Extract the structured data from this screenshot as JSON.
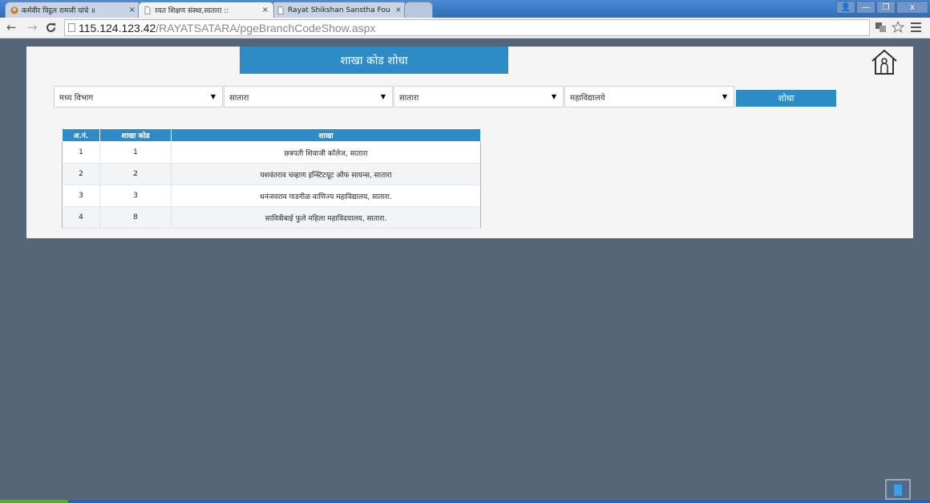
{
  "browser": {
    "tabs": [
      {
        "label": "कर्मवीर विट्ठल रामजी यांचे ॥",
        "active": false
      },
      {
        "label": "रयत शिक्षण संस्था,सातारा :: ",
        "active": true
      },
      {
        "label": "Rayat Shikshan Sanstha Fou",
        "active": false
      }
    ],
    "close_glyph": "×",
    "window_buttons": {
      "user": "👤",
      "minimize": "—",
      "maximize": "❐",
      "close": "x"
    },
    "url_host": "115.124.123.42",
    "url_path": "/RAYATSATARA/pgeBranchCodeShow.aspx"
  },
  "page": {
    "title": "शाखा कोड शोधा",
    "filters": [
      {
        "value": "मध्य विभाग"
      },
      {
        "value": "सातारा"
      },
      {
        "value": "सातारा"
      },
      {
        "value": "महाविद्यालये"
      }
    ],
    "search_label": "शोधा",
    "table": {
      "headers": [
        "अ.नं.",
        "शाखा कोड",
        "शाखा"
      ],
      "rows": [
        {
          "no": "1",
          "code": "1",
          "name": "छत्रपती शिवाजी कॉलेज, सातारा"
        },
        {
          "no": "2",
          "code": "2",
          "name": "यशवंतराव चव्हाण इन्स्टिटयूट ऑफ सायन्स, सातारा"
        },
        {
          "no": "3",
          "code": "3",
          "name": "धनंजयराव गाडगीळ वाणिज्य महाविद्यालय, सातारा."
        },
        {
          "no": "4",
          "code": "8",
          "name": "सावित्रीबाई फुले महिला महाविदयालय, सातारा."
        }
      ]
    }
  },
  "colors": {
    "accent": "#2d8bc6",
    "page_bg": "#566577",
    "panel_bg": "#f5f5f5"
  }
}
